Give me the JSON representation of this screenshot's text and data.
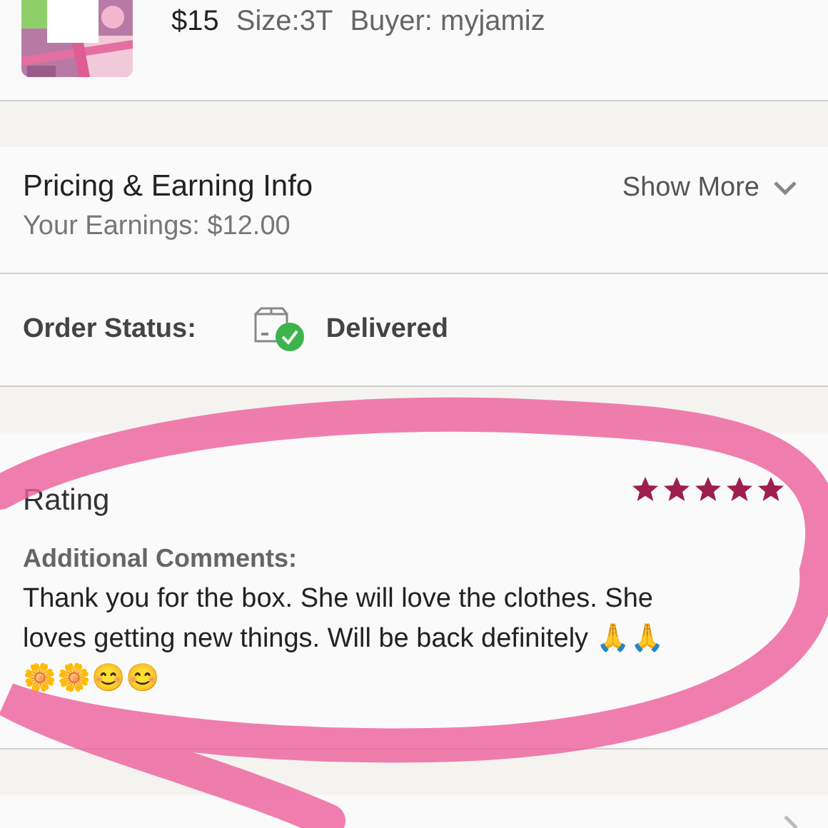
{
  "item": {
    "price": "$15",
    "size": "Size:3T",
    "buyer": "Buyer: myjamiz"
  },
  "pricing": {
    "title": "Pricing & Earning Info",
    "earnings": "Your Earnings: $12.00",
    "toggle": "Show More"
  },
  "order_status": {
    "label": "Order Status:",
    "value": "Delivered"
  },
  "rating": {
    "title": "Rating",
    "stars": 5,
    "comments_label": "Additional Comments:",
    "comment": "Thank you for the box. She will love the clothes. She loves getting new things. Will be back definitely 🙏🙏🌼🌼😊😊"
  }
}
